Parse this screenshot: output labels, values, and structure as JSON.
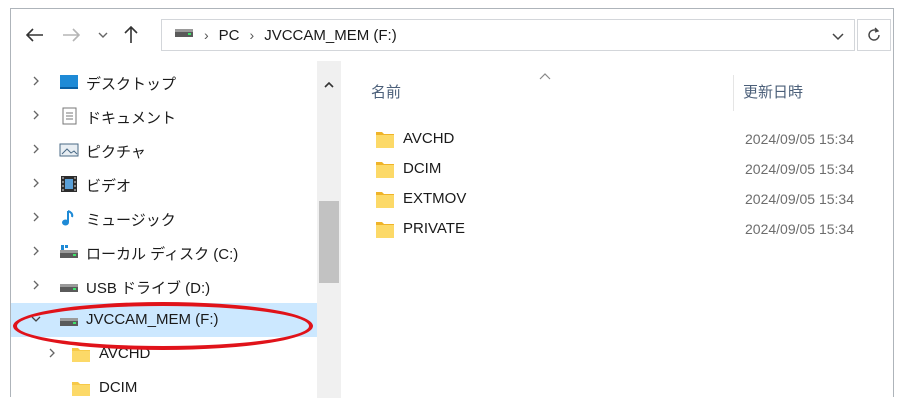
{
  "toolbar": {
    "back_icon": "arrow-left-icon",
    "forward_icon": "arrow-right-icon",
    "recent_icon": "chevron-down-icon",
    "up_icon": "arrow-up-icon"
  },
  "address": {
    "breadcrumbs": [
      "PC",
      "JVCCAM_MEM (F:)"
    ],
    "dropdown_icon": "chevron-down-icon",
    "refresh_icon": "refresh-icon"
  },
  "nav": {
    "items": [
      {
        "label": "デスクトップ",
        "icon": "desktop-icon",
        "expand": "collapsed"
      },
      {
        "label": "ドキュメント",
        "icon": "documents-icon",
        "expand": "collapsed"
      },
      {
        "label": "ピクチャ",
        "icon": "pictures-icon",
        "expand": "collapsed"
      },
      {
        "label": "ビデオ",
        "icon": "videos-icon",
        "expand": "collapsed"
      },
      {
        "label": "ミュージック",
        "icon": "music-icon",
        "expand": "collapsed"
      },
      {
        "label": "ローカル ディスク (C:)",
        "icon": "local-disk-icon",
        "expand": "collapsed"
      },
      {
        "label": "USB ドライブ (D:)",
        "icon": "usb-drive-icon",
        "expand": "collapsed"
      },
      {
        "label": "JVCCAM_MEM (F:)",
        "icon": "drive-icon",
        "expand": "expanded",
        "selected": true
      },
      {
        "label": "AVCHD",
        "icon": "folder-icon",
        "expand": "collapsed"
      },
      {
        "label": "DCIM",
        "icon": "folder-icon",
        "expand": "none"
      }
    ]
  },
  "columns": {
    "name": "名前",
    "date": "更新日時"
  },
  "files": [
    {
      "name": "AVCHD",
      "date": "2024/09/05 15:34"
    },
    {
      "name": "DCIM",
      "date": "2024/09/05 15:34"
    },
    {
      "name": "EXTMOV",
      "date": "2024/09/05 15:34"
    },
    {
      "name": "PRIVATE",
      "date": "2024/09/05 15:34"
    }
  ],
  "colors": {
    "selection": "#cce8ff",
    "highlight_ellipse": "#e0131a",
    "folder": "#f7c948"
  }
}
